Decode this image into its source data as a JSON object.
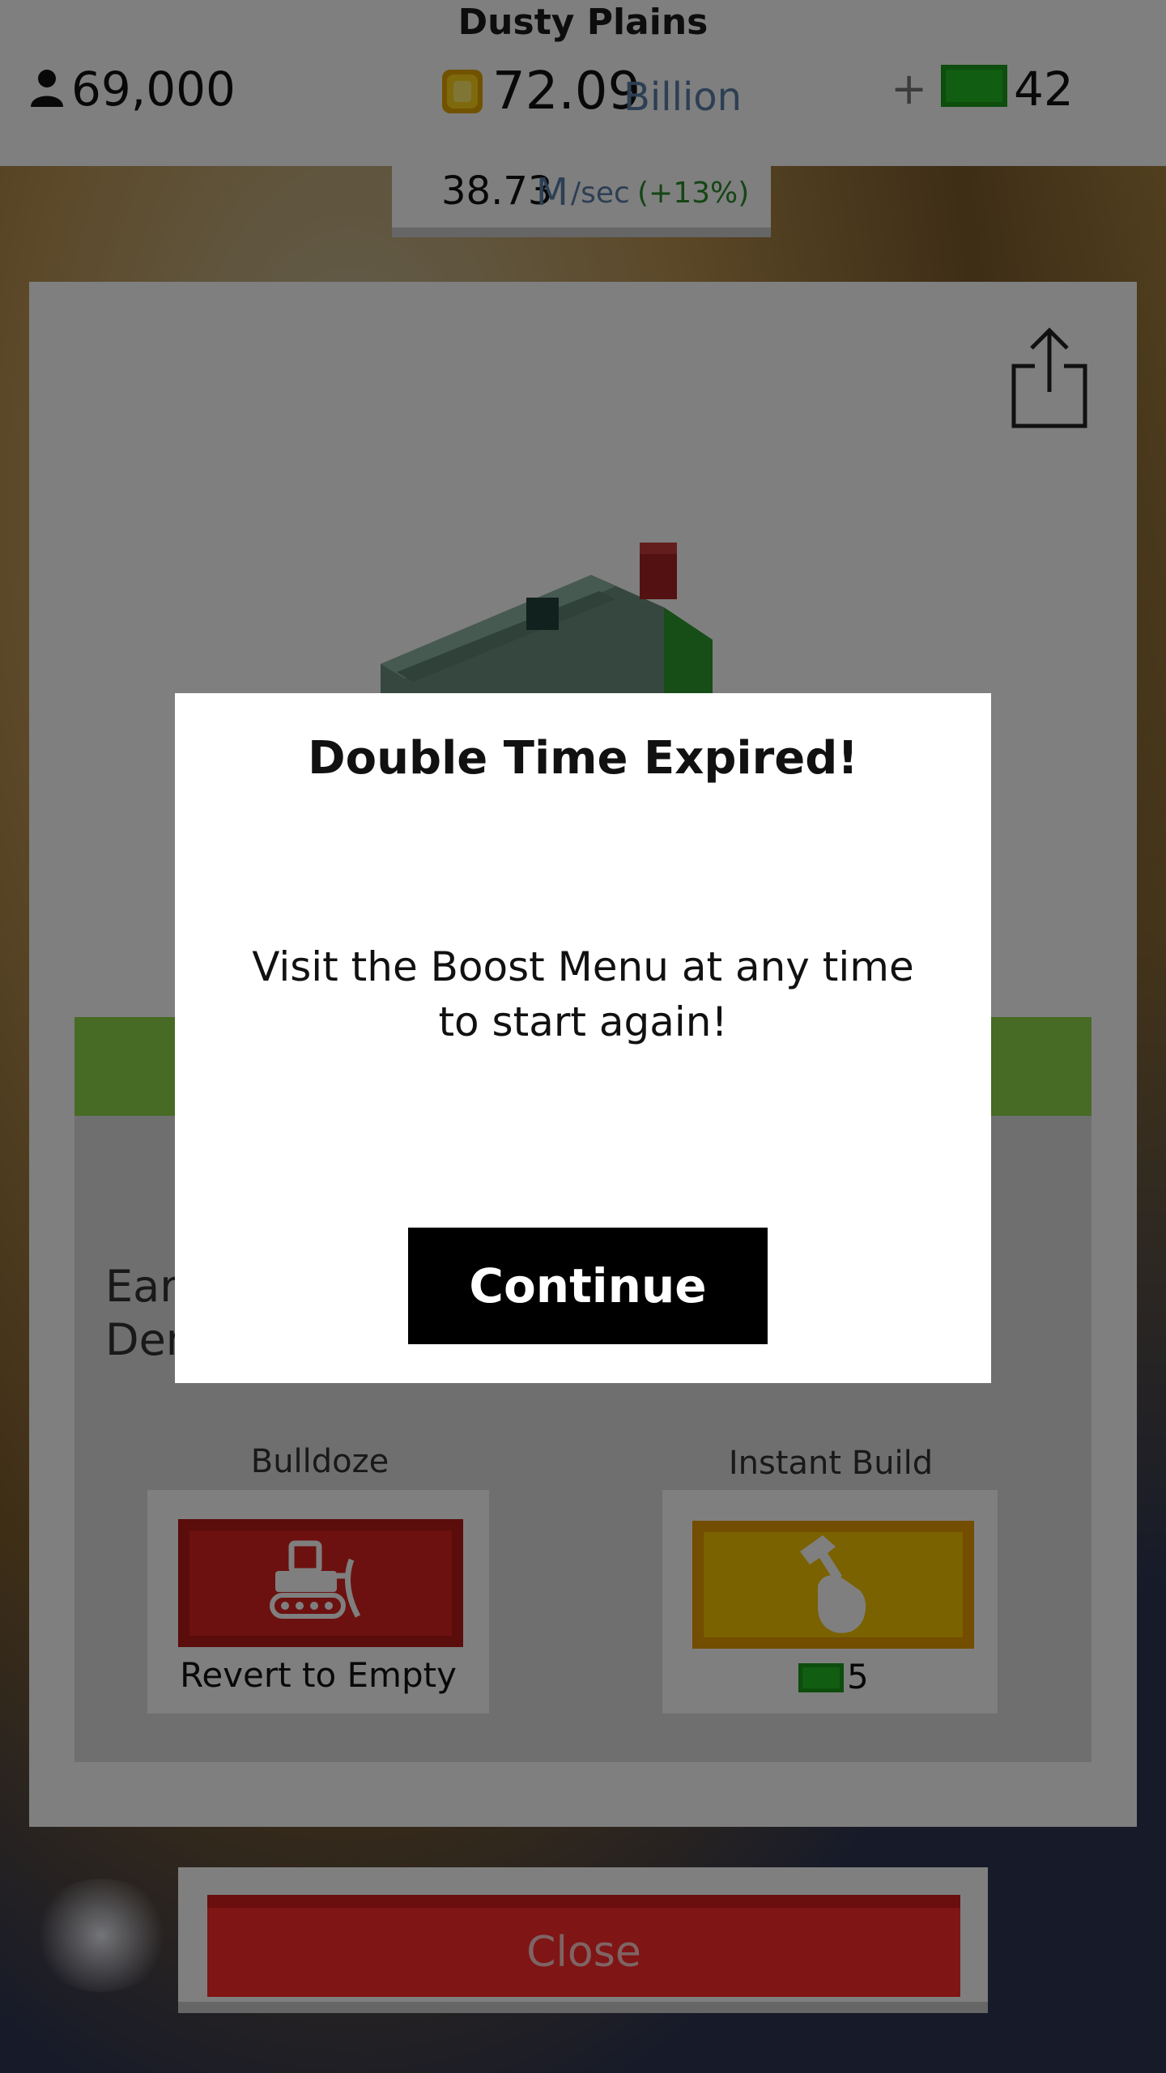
{
  "header": {
    "location": "Dusty Plains",
    "population": "69,000",
    "money_value": "72.09",
    "money_unit": "Billion",
    "plus_label": "+",
    "bux": "42"
  },
  "income": {
    "value": "38.73",
    "unit_m": "M",
    "unit_sec": "/sec",
    "bonus": "(+13%)"
  },
  "panel": {
    "earn_text_line1": "Earn",
    "earn_text_line2": "Dem",
    "bulldoze_label": "Bulldoze",
    "revert_label": "Revert to Empty",
    "instant_build_label": "Instant Build",
    "instant_build_cost": "5",
    "close_label": "Close"
  },
  "modal": {
    "title": "Double Time Expired!",
    "body": "Visit the Boost Menu at any time to start again!",
    "continue_label": "Continue"
  },
  "icons": [
    "person-icon",
    "coin-icon",
    "bux-icon",
    "share-icon",
    "bulldozer-icon",
    "hammer-hand-icon"
  ],
  "colors": {
    "bulldoze_red": "#d9231f",
    "instant_yellow": "#f4c400",
    "close_red": "#ff2a2a",
    "bux_green": "#22bb22",
    "status_green": "#8fd548"
  }
}
